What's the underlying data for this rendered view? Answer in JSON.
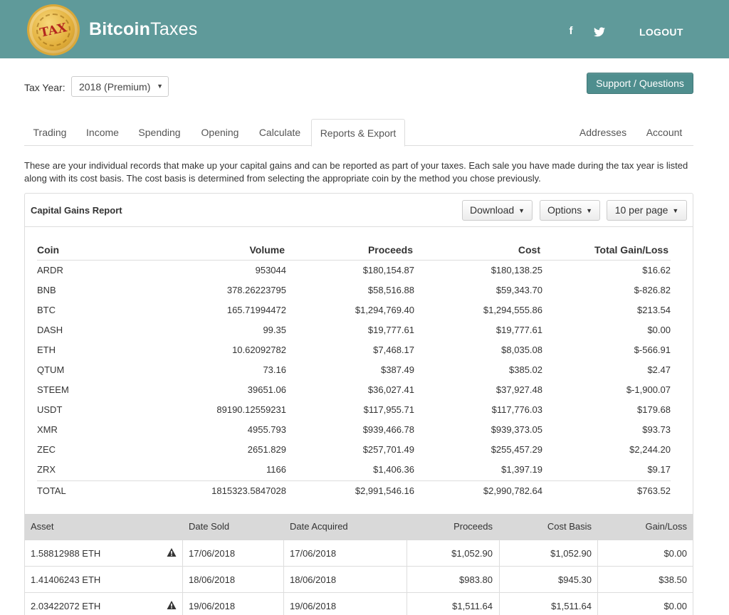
{
  "header": {
    "logo_text": "TAX",
    "brand_bold": "Bitcoin",
    "brand_light": "Taxes",
    "facebook_icon": "f",
    "logout": "LOGOUT"
  },
  "controls": {
    "tax_year_label": "Tax Year:",
    "tax_year_value": "2018 (Premium)",
    "support_button": "Support / Questions"
  },
  "tabs": [
    {
      "label": "Trading"
    },
    {
      "label": "Income"
    },
    {
      "label": "Spending"
    },
    {
      "label": "Opening"
    },
    {
      "label": "Calculate"
    },
    {
      "label": "Reports & Export",
      "active": true
    },
    {
      "label": "Addresses"
    },
    {
      "label": "Account"
    }
  ],
  "intro": "These are your individual records that make up your capital gains and can be reported as part of your taxes. Each sale you have made during the tax year is listed along with its cost basis. The cost basis is determined from selecting the appropriate coin by the method you chose previously.",
  "report": {
    "title": "Capital Gains Report",
    "download_button": "Download",
    "options_button": "Options",
    "per_page_button": "10 per page",
    "summary_columns": [
      "Coin",
      "Volume",
      "Proceeds",
      "Cost",
      "Total Gain/Loss"
    ],
    "summary_rows": [
      [
        "ARDR",
        "953044",
        "$180,154.87",
        "$180,138.25",
        "$16.62"
      ],
      [
        "BNB",
        "378.26223795",
        "$58,516.88",
        "$59,343.70",
        "$-826.82"
      ],
      [
        "BTC",
        "165.71994472",
        "$1,294,769.40",
        "$1,294,555.86",
        "$213.54"
      ],
      [
        "DASH",
        "99.35",
        "$19,777.61",
        "$19,777.61",
        "$0.00"
      ],
      [
        "ETH",
        "10.62092782",
        "$7,468.17",
        "$8,035.08",
        "$-566.91"
      ],
      [
        "QTUM",
        "73.16",
        "$387.49",
        "$385.02",
        "$2.47"
      ],
      [
        "STEEM",
        "39651.06",
        "$36,027.41",
        "$37,927.48",
        "$-1,900.07"
      ],
      [
        "USDT",
        "89190.12559231",
        "$117,955.71",
        "$117,776.03",
        "$179.68"
      ],
      [
        "XMR",
        "4955.793",
        "$939,466.78",
        "$939,373.05",
        "$93.73"
      ],
      [
        "ZEC",
        "2651.829",
        "$257,701.49",
        "$255,457.29",
        "$2,244.20"
      ],
      [
        "ZRX",
        "1166",
        "$1,406.36",
        "$1,397.19",
        "$9.17"
      ]
    ],
    "summary_total": [
      "TOTAL",
      "1815323.5847028",
      "$2,991,546.16",
      "$2,990,782.64",
      "$763.52"
    ],
    "detail_columns": [
      "Asset",
      "Date Sold",
      "Date Acquired",
      "Proceeds",
      "Cost Basis",
      "Gain/Loss"
    ],
    "detail_rows": [
      {
        "asset": "1.58812988 ETH",
        "warning": true,
        "sold": "17/06/2018",
        "acquired": "17/06/2018",
        "proceeds": "$1,052.90",
        "cost": "$1,052.90",
        "gain": "$0.00"
      },
      {
        "asset": "1.41406243 ETH",
        "warning": false,
        "sold": "18/06/2018",
        "acquired": "18/06/2018",
        "proceeds": "$983.80",
        "cost": "$945.30",
        "gain": "$38.50"
      },
      {
        "asset": "2.03422072 ETH",
        "warning": true,
        "sold": "19/06/2018",
        "acquired": "19/06/2018",
        "proceeds": "$1,511.64",
        "cost": "$1,511.64",
        "gain": "$0.00"
      }
    ]
  },
  "colors": {
    "header_bg": "#5f9a9a",
    "support_button_bg": "#4f8e8e",
    "table_header_bg": "#d9d9d9"
  },
  "icons": [
    "logo-coin-icon",
    "facebook-icon",
    "twitter-icon",
    "warning-icon",
    "caret-down-icon"
  ]
}
